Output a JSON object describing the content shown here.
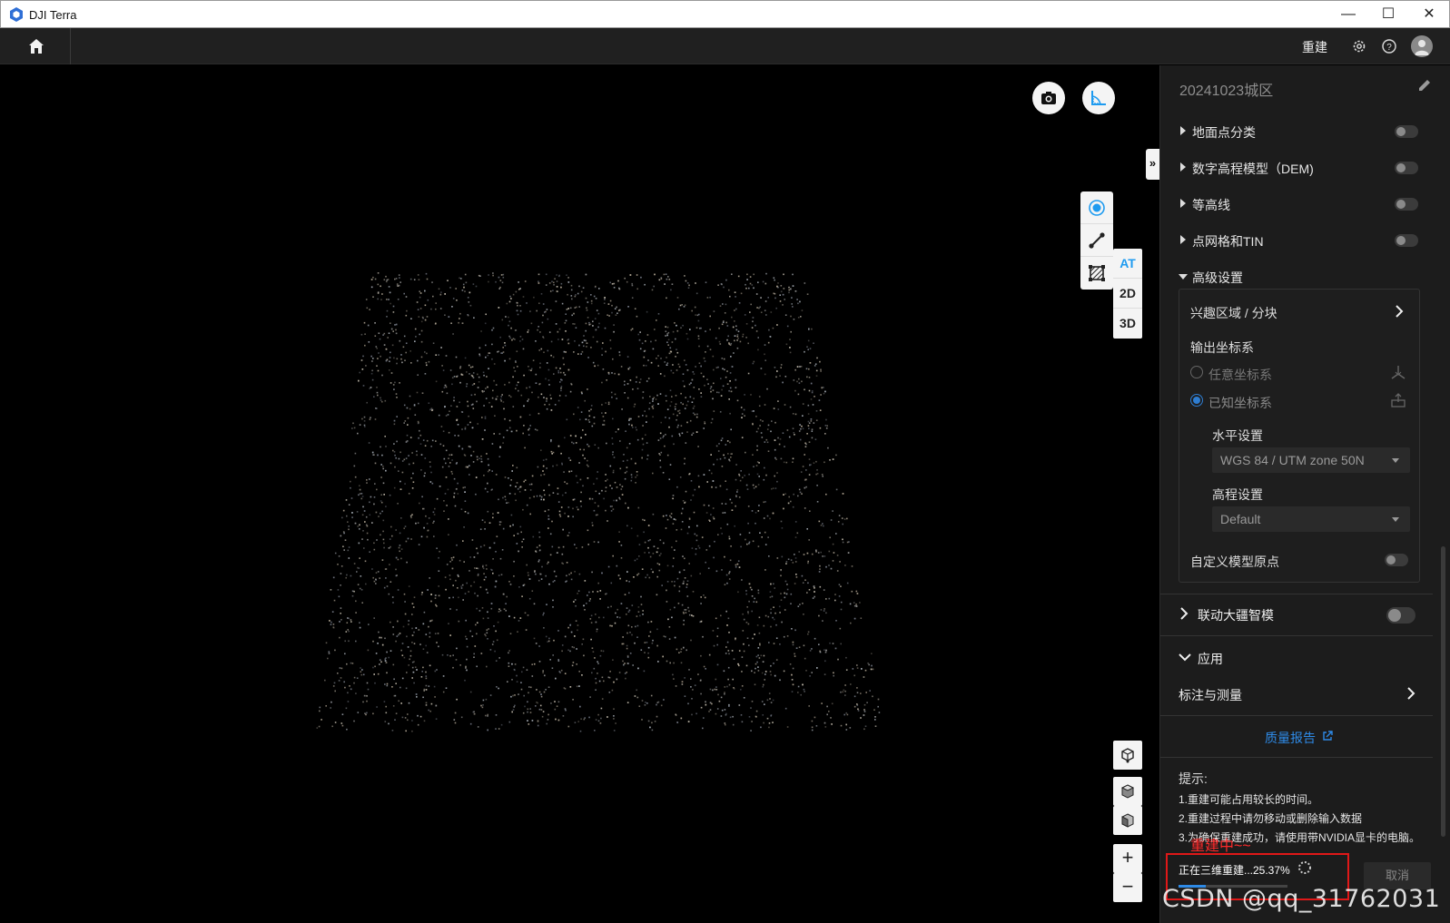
{
  "window": {
    "app_title": "DJI Terra",
    "minimize": "—",
    "maximize": "☐",
    "close": "✕"
  },
  "appbar": {
    "home_icon": "home-icon",
    "rebuild_label": "重建",
    "settings_icon": "gear-icon",
    "help_icon": "help-icon",
    "avatar_icon": "user-avatar-icon"
  },
  "viewport": {
    "camera_icon": "camera-icon",
    "measure_icon": "ruler-angle-icon",
    "collapse_label": "»",
    "tools": [
      "point-icon",
      "line-icon",
      "area-icon"
    ],
    "modes": [
      {
        "label": "AT",
        "active": true
      },
      {
        "label": "2D",
        "active": false
      },
      {
        "label": "3D",
        "active": false
      }
    ],
    "zoom_in": "+",
    "zoom_out": "−"
  },
  "panel": {
    "project_title": "20241023城区",
    "sections": [
      {
        "label": "地面点分类",
        "expanded": false,
        "enabled": false
      },
      {
        "label": "数字高程模型（DEM)",
        "expanded": false,
        "enabled": false
      },
      {
        "label": "等高线",
        "expanded": false,
        "enabled": false
      },
      {
        "label": "点网格和TIN",
        "expanded": false,
        "enabled": false
      },
      {
        "label": "高级设置",
        "expanded": true
      }
    ],
    "advanced": {
      "roi_label": "兴趣区域 / 分块",
      "output_coord_label": "输出坐标系",
      "arbitrary_coord": "任意坐标系",
      "known_coord": "已知坐标系",
      "horizontal_label": "水平设置",
      "horizontal_value": "WGS 84 / UTM zone 50N",
      "elevation_label": "高程设置",
      "elevation_value": "Default",
      "custom_origin_label": "自定义模型原点"
    },
    "linkage_label": "联动大疆智模",
    "application_label": "应用",
    "annotate_label": "标注与测量",
    "quality_report": "质量报告",
    "tips_title": "提示:",
    "tips": [
      "1.重建可能占用较长的时间。",
      "2.重建过程中请勿移动或删除输入数据",
      "3.为确保重建成功，请使用带NVIDIA显卡的电脑。"
    ],
    "rebuilding_note": "重建中~~",
    "progress_text": "正在三维重建...25.37%",
    "progress_percent": 25.37,
    "cancel_label": "取消"
  },
  "watermark": "CSDN @qq_31762031",
  "colors": {
    "accent": "#1e9bf0",
    "panel_bg": "#1c1c1c",
    "highlight_red": "#e01818"
  }
}
